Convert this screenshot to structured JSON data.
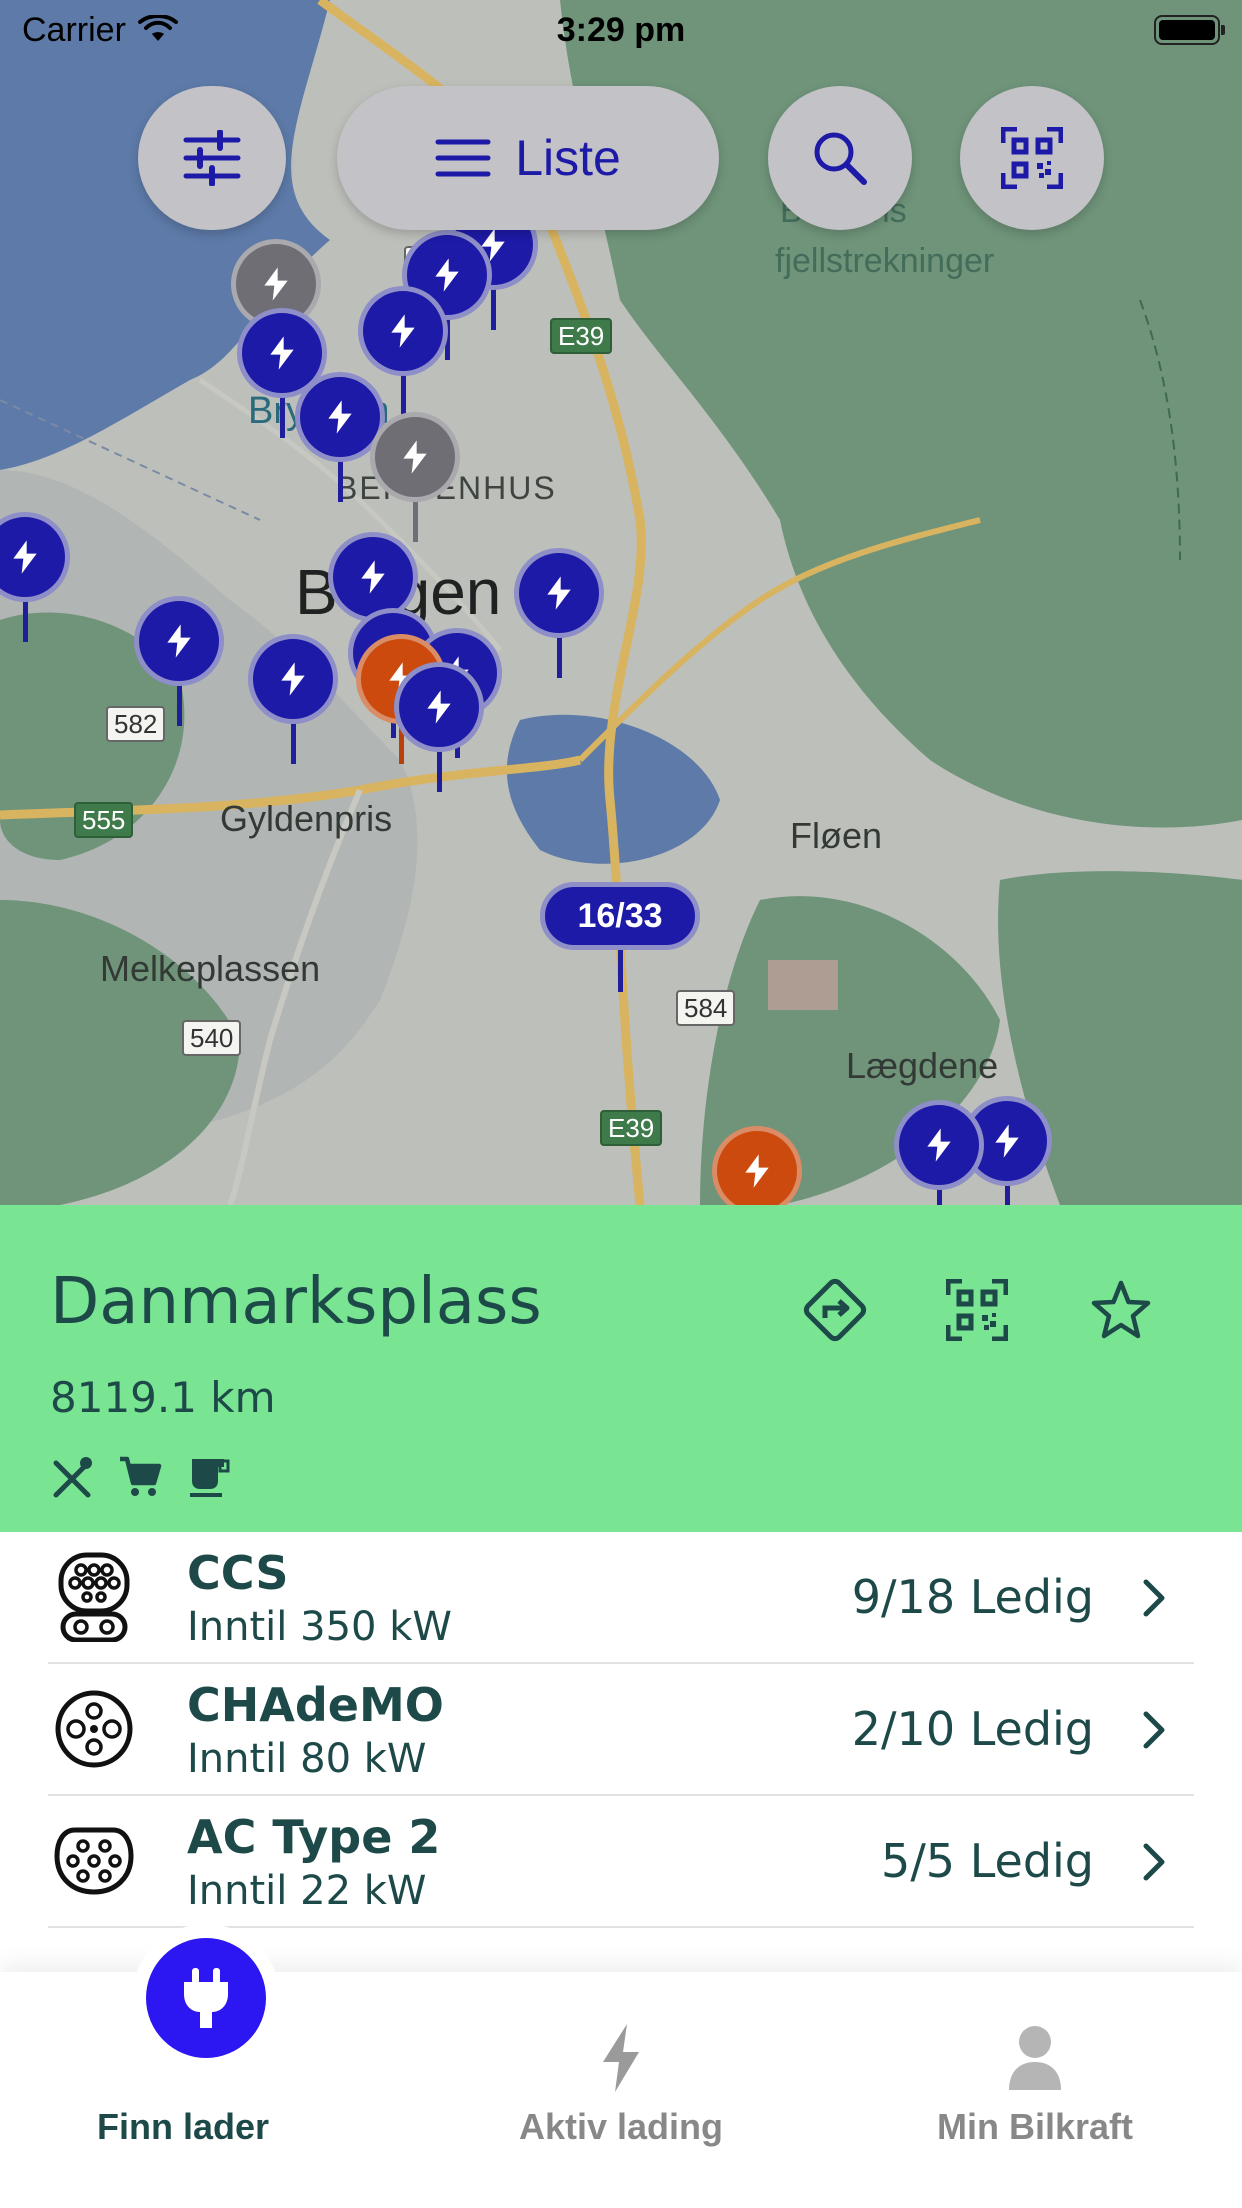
{
  "status_bar": {
    "carrier": "Carrier",
    "time": "3:29 pm"
  },
  "map": {
    "list_button_label": "Liste",
    "cluster_label": "16/33",
    "labels": {
      "city": "Bergen",
      "district": "BERGENHUS",
      "gyldenpris": "Gyldenpris",
      "floen": "Fløen",
      "melkeplassen": "Melkeplassen",
      "laegdene": "Lægdene",
      "park_line1": "Bergens",
      "park_line2": "fjellstrekninger",
      "bryggen": "Bryggen"
    },
    "road_shields": [
      "582",
      "555",
      "540",
      "584",
      "E39",
      "E39",
      "57"
    ]
  },
  "station": {
    "name": "Danmarksplass",
    "distance": "8119.1 km",
    "amenities": [
      "restaurant-icon",
      "shopping-cart-icon",
      "coffee-icon"
    ]
  },
  "connectors": [
    {
      "name": "CCS",
      "power": "Inntil 350 kW",
      "availability": "9/18 Ledig",
      "icon": "ccs-connector-icon"
    },
    {
      "name": "CHAdeMO",
      "power": "Inntil 80 kW",
      "availability": "2/10 Ledig",
      "icon": "chademo-connector-icon"
    },
    {
      "name": "AC Type 2",
      "power": "Inntil 22 kW",
      "availability": "5/5 Ledig",
      "icon": "type2-connector-icon"
    }
  ],
  "tabs": [
    {
      "label": "Finn lader",
      "icon": "plug-icon",
      "active": true
    },
    {
      "label": "Aktiv lading",
      "icon": "bolt-icon",
      "active": false
    },
    {
      "label": "Min Bilkraft",
      "icon": "person-icon",
      "active": false
    }
  ],
  "colors": {
    "accent": "#2c16f2",
    "pin_available": "#1e1aa8",
    "pin_busy": "#cc4a0d",
    "pin_offline": "#6e6e74",
    "panel_bg": "#79e491",
    "text_dark": "#1d4a49"
  }
}
